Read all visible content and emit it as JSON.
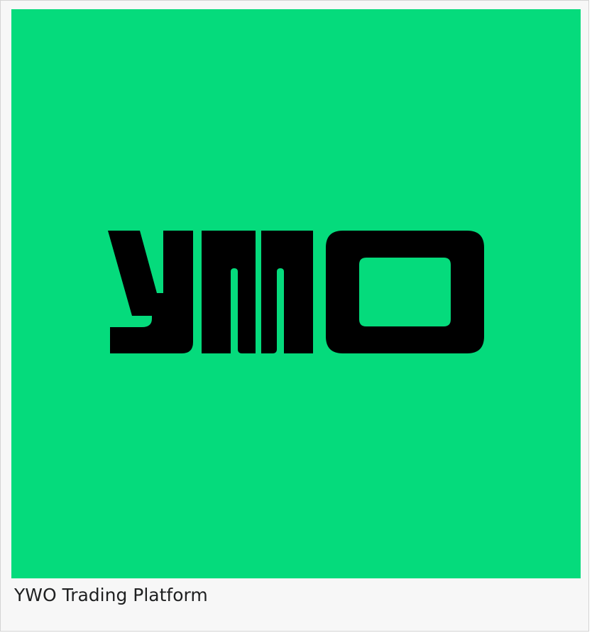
{
  "figure": {
    "logo_text": "YWO",
    "caption": "YWO Trading Platform",
    "colors": {
      "background": "#05DB7C",
      "logo": "#000000",
      "frame": "#F7F7F7",
      "border": "#D4D4D4",
      "caption_text": "#202122"
    }
  }
}
